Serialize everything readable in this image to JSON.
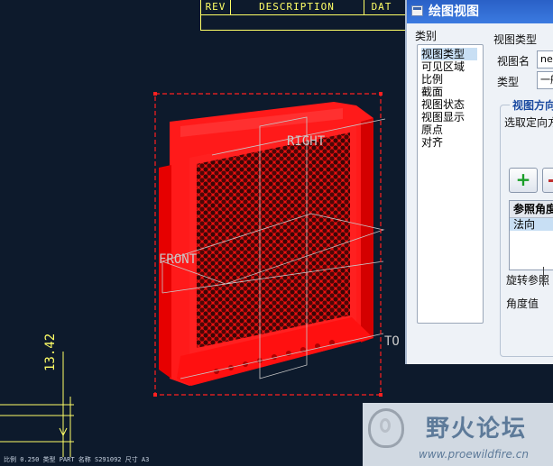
{
  "drawing": {
    "title_block": {
      "rev": "REV",
      "description": "DESCRIPTION",
      "date": "DAT"
    },
    "model_labels": {
      "right": "RIGHT",
      "front": "FRONT",
      "top": "TO"
    },
    "dimension": "13.42",
    "status_bar": "比例 0.250   类型 PART   名称 S291092   尺寸 A3",
    "colors": {
      "background": "#0d1a2c",
      "part": "#ff0000",
      "frame": "#ffff66",
      "selection": "#ff0000"
    }
  },
  "dialog": {
    "title": "绘图视图",
    "category_label": "类别",
    "categories": [
      "视图类型",
      "可见区域",
      "比例",
      "截面",
      "视图状态",
      "视图显示",
      "原点",
      "对齐"
    ],
    "selected_category": "视图类型",
    "view_type_section": "视图类型",
    "view_name_label": "视图名",
    "view_name_value": "new",
    "type_label": "类型",
    "type_value": "一般",
    "orientation_group": "视图方向",
    "orientation_prompt": "选取定向方",
    "add_button": "+",
    "ref_table": {
      "header": "参照角度",
      "row": "法向"
    },
    "rotate_ref_label": "旋转参照",
    "angle_label": "角度值"
  },
  "watermark": {
    "text": "野火论坛",
    "url": "www.proewildfire.cn"
  }
}
